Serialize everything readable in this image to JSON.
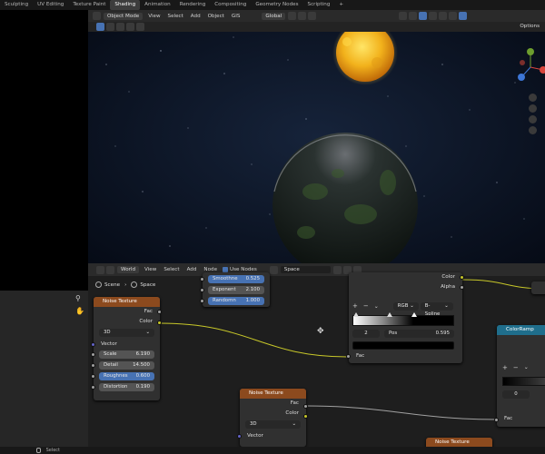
{
  "workspace_tabs": [
    "Sculpting",
    "UV Editing",
    "Texture Paint",
    "Shading",
    "Animation",
    "Rendering",
    "Compositing",
    "Geometry Nodes",
    "Scripting",
    "+"
  ],
  "viewport": {
    "mode": "Object Mode",
    "menus": [
      "View",
      "Select",
      "Add",
      "Object",
      "GIS"
    ],
    "transform": "Global",
    "options_label": "Options"
  },
  "node_editor": {
    "shader_type": "World",
    "menus": [
      "View",
      "Select",
      "Add",
      "Node"
    ],
    "use_nodes_label": "Use Nodes",
    "world_name": "Space",
    "breadcrumb": [
      "Scene",
      "Space"
    ],
    "top_node_fields": [
      {
        "label": "Smoothne",
        "value": "0.525",
        "highlight": true
      },
      {
        "label": "Exponent",
        "value": "2.100",
        "highlight": false
      },
      {
        "label": "Randomn",
        "value": "1.000",
        "highlight": true
      }
    ],
    "noise_texture_1": {
      "title": "Noise Texture",
      "outputs": [
        "Fac",
        "Color"
      ],
      "dimension": "3D",
      "input_vector": "Vector",
      "fields": [
        {
          "label": "Scale",
          "value": "6.190",
          "highlight": false
        },
        {
          "label": "Detail",
          "value": "14.500",
          "highlight": false
        },
        {
          "label": "Roughnes",
          "value": "0.600",
          "highlight": true
        },
        {
          "label": "Distortion",
          "value": "0.190",
          "highlight": false
        }
      ]
    },
    "noise_texture_2": {
      "title": "Noise Texture",
      "outputs": [
        "Fac",
        "Color"
      ],
      "dimension": "3D",
      "input_vector": "Vector"
    },
    "noise_texture_3_title": "Noise Texture",
    "color_ramp_1": {
      "interpolation_mode": "RGB",
      "interpolation": "B-Spline",
      "index": "2",
      "pos_label": "Pos",
      "pos_value": "0.595",
      "input_fac": "Fac",
      "outputs": [
        "Color",
        "Alpha"
      ]
    },
    "color_ramp_2": {
      "title": "ColorRamp",
      "index": "0",
      "input_fac": "Fac"
    }
  },
  "status": {
    "select_label": "Select"
  },
  "colors": {
    "accent_blue": "#4772b3",
    "node_header_texture": "#8c4a1e",
    "node_header_converter": "#1f6e8c",
    "socket_yellow": "#c7c729",
    "socket_gray": "#a1a1a1",
    "socket_purple": "#6363c7"
  }
}
